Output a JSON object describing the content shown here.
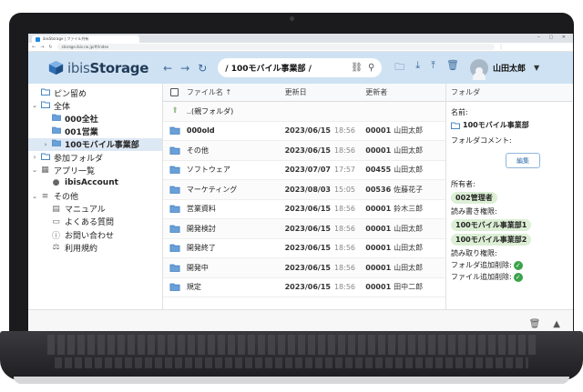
{
  "browser": {
    "tab_title": "ibisStorage | ファイル共有",
    "url": "storage.ibis.ne.jp/#/index"
  },
  "header": {
    "logo_prefix": "ibis",
    "logo_suffix": "Storage",
    "path": "/ 100モバイル事業部 /",
    "user_name": "山田太郎"
  },
  "sidebar": {
    "items": [
      {
        "label": "ピン留め",
        "icon": "folder-outline-icon",
        "arrow": "",
        "indent": 0
      },
      {
        "label": "全体",
        "icon": "folder-outline-icon",
        "arrow": "⌄",
        "indent": 0
      },
      {
        "label": "000全社",
        "icon": "folder-icon",
        "arrow": "",
        "indent": 1,
        "bold": true
      },
      {
        "label": "001営業",
        "icon": "folder-icon",
        "arrow": "",
        "indent": 1,
        "bold": true
      },
      {
        "label": "100モバイル事業部",
        "icon": "folder-icon",
        "arrow": "›",
        "indent": 1,
        "bold": true,
        "selected": true
      },
      {
        "label": "参加フォルダ",
        "icon": "folder-outline-icon",
        "arrow": "›",
        "indent": 0
      },
      {
        "label": "アプリ一覧",
        "icon": "grid-icon",
        "arrow": "⌄",
        "indent": 0
      },
      {
        "label": "ibisAccount",
        "icon": "drop-icon",
        "arrow": "",
        "indent": 1,
        "bold": true
      },
      {
        "label": "その他",
        "icon": "menu-icon",
        "arrow": "⌄",
        "indent": 0
      },
      {
        "label": "マニュアル",
        "icon": "book-icon",
        "arrow": "",
        "indent": 1
      },
      {
        "label": "よくある質問",
        "icon": "chat-icon",
        "arrow": "",
        "indent": 1
      },
      {
        "label": "お問い合わせ",
        "icon": "info-icon",
        "arrow": "",
        "indent": 1
      },
      {
        "label": "利用規約",
        "icon": "scale-icon",
        "arrow": "",
        "indent": 1
      }
    ]
  },
  "filelist": {
    "columns": {
      "name": "ファイル名 ↑",
      "date": "更新日",
      "user": "更新者"
    },
    "rows": [
      {
        "name": "..(親フォルダ)",
        "date": "",
        "time": "",
        "user_id": "",
        "user_name": "",
        "bold": false,
        "parent": true
      },
      {
        "name": "000old",
        "date": "2023/06/15",
        "time": "18:56",
        "user_id": "00001",
        "user_name": "山田太郎",
        "bold": true
      },
      {
        "name": "その他",
        "date": "2023/06/15",
        "time": "18:56",
        "user_id": "00001",
        "user_name": "山田太郎"
      },
      {
        "name": "ソフトウェア",
        "date": "2023/07/07",
        "time": "17:57",
        "user_id": "00455",
        "user_name": "山田太郎"
      },
      {
        "name": "マーケティング",
        "date": "2023/08/03",
        "time": "15:05",
        "user_id": "00536",
        "user_name": "佐藤花子"
      },
      {
        "name": "営業資料",
        "date": "2023/06/15",
        "time": "18:56",
        "user_id": "00001",
        "user_name": "鈴木三郎"
      },
      {
        "name": "開発検討",
        "date": "2023/06/15",
        "time": "18:56",
        "user_id": "00001",
        "user_name": "山田太郎"
      },
      {
        "name": "開発終了",
        "date": "2023/06/15",
        "time": "18:56",
        "user_id": "00001",
        "user_name": "山田太郎"
      },
      {
        "name": "開発中",
        "date": "2023/06/15",
        "time": "18:56",
        "user_id": "00001",
        "user_name": "山田太郎"
      },
      {
        "name": "規定",
        "date": "2023/06/15",
        "time": "18:56",
        "user_id": "00001",
        "user_name": "田中二郎"
      }
    ]
  },
  "detail": {
    "title": "フォルダ",
    "name_label": "名前:",
    "name_value": "100モバイル事業部",
    "comment_label": "フォルダコメント:",
    "edit_button": "編集",
    "owner_label": "所有者:",
    "owner_value": "002管理者",
    "rw_label": "読み書き権限:",
    "rw_values": [
      "100モバイル事業部1",
      "100モバイル事業部2"
    ],
    "ro_label": "読み取り権限:",
    "add_folder_label": "フォルダ追加削除:",
    "add_file_label": "ファイル追加削除:"
  },
  "colors": {
    "header_bg": "#cfe2f3",
    "folder": "#4a86c5",
    "check": "#3aa34a",
    "pill": "#dcefd5"
  }
}
